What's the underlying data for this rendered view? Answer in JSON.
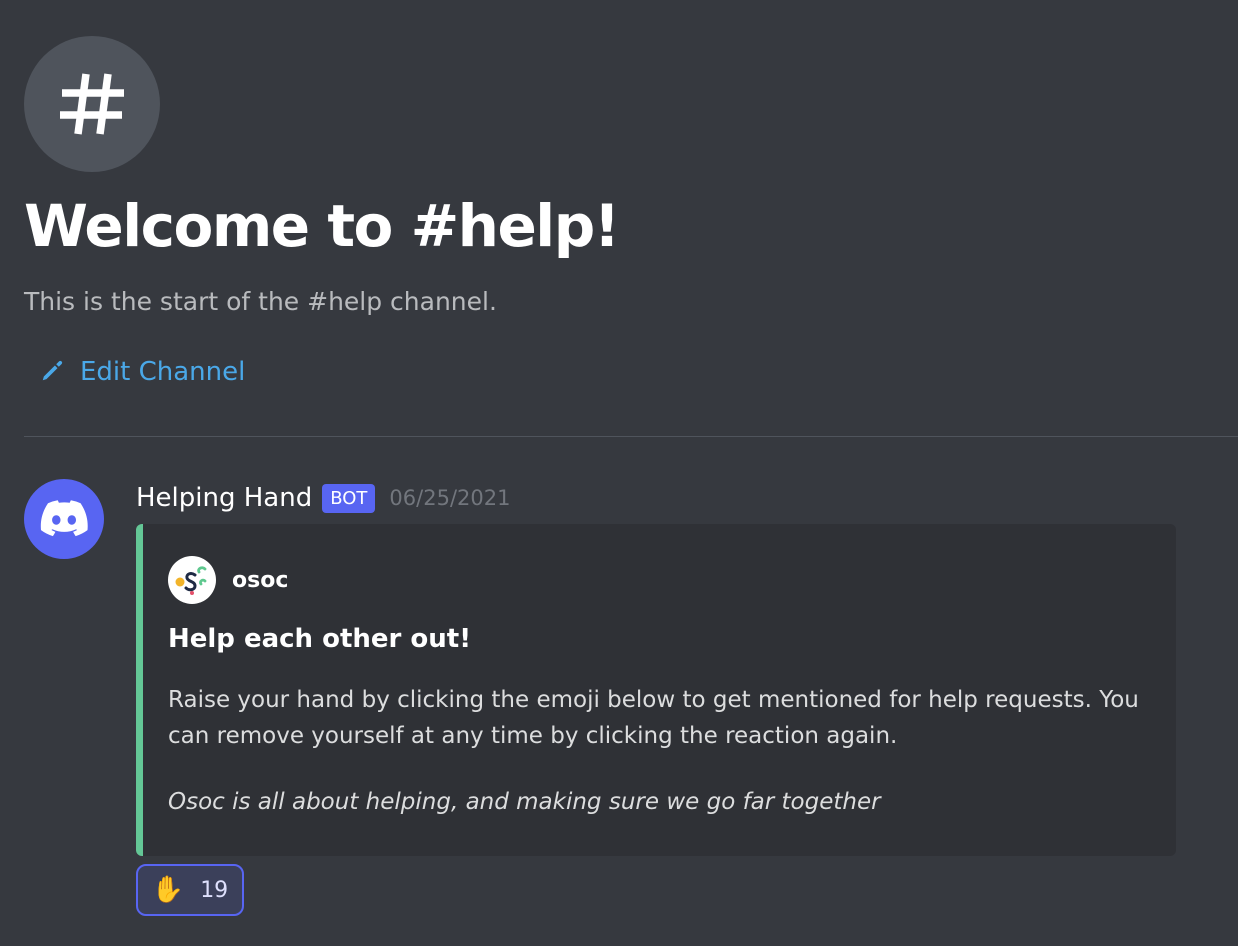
{
  "channel": {
    "icon": "hash-icon",
    "welcome_title": "Welcome to #help!",
    "welcome_subtitle": "This is the start of the #help channel.",
    "edit_label": "Edit Channel",
    "edit_icon": "pencil-icon"
  },
  "message": {
    "avatar_icon": "discord-logo-icon",
    "author": "Helping Hand",
    "bot_tag": "BOT",
    "timestamp": "06/25/2021",
    "embed": {
      "accent_color": "#64c796",
      "author_icon": "osoc-logo-icon",
      "author_name": "osoc",
      "title": "Help each other out!",
      "description": "Raise your hand by clicking the emoji below to get mentioned for help requests. You can remove yourself at any time by clicking the reaction again.",
      "quote": "Osoc is all about helping, and making sure we go far together"
    },
    "reaction": {
      "emoji": "✋",
      "count": "19"
    }
  },
  "colors": {
    "background": "#36393f",
    "blurple": "#5865f2",
    "link": "#4aa8e8",
    "embed_bg": "#2f3136"
  }
}
